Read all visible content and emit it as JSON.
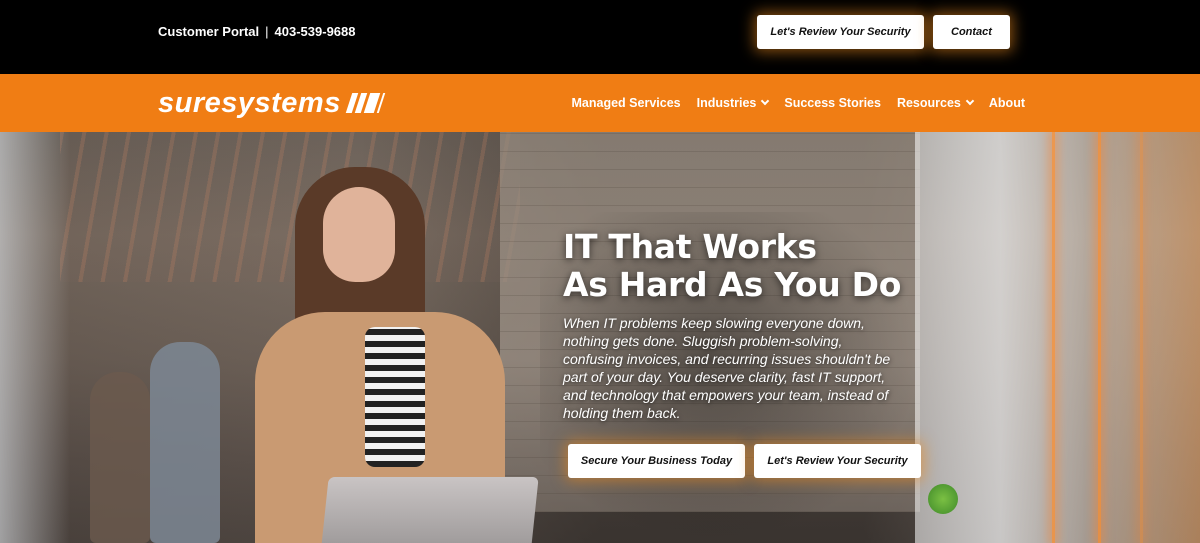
{
  "topbar": {
    "portal_label": "Customer Portal",
    "separator": "|",
    "phone": "403-539-9688",
    "review_button": "Let's Review Your Security",
    "contact_button": "Contact"
  },
  "nav": {
    "logo_text": "suresystems",
    "items": [
      {
        "label": "Managed Services",
        "has_dropdown": false
      },
      {
        "label": "Industries",
        "has_dropdown": true
      },
      {
        "label": "Success Stories",
        "has_dropdown": false
      },
      {
        "label": "Resources",
        "has_dropdown": true
      },
      {
        "label": "About",
        "has_dropdown": false
      }
    ]
  },
  "hero": {
    "title_line1": "IT That Works",
    "title_line2": "As Hard As You Do",
    "body": "When IT problems keep slowing everyone down, nothing gets done. Sluggish problem-solving, confusing invoices, and recurring issues shouldn't be part of your day. You deserve clarity, fast IT support, and technology that empowers your team, instead of holding them back.",
    "secure_button": "Secure Your Business Today",
    "review_button": "Let's Review Your Security"
  },
  "colors": {
    "brand_orange": "#f07d14",
    "topbar_bg": "#000000",
    "button_bg": "#ffffff"
  }
}
